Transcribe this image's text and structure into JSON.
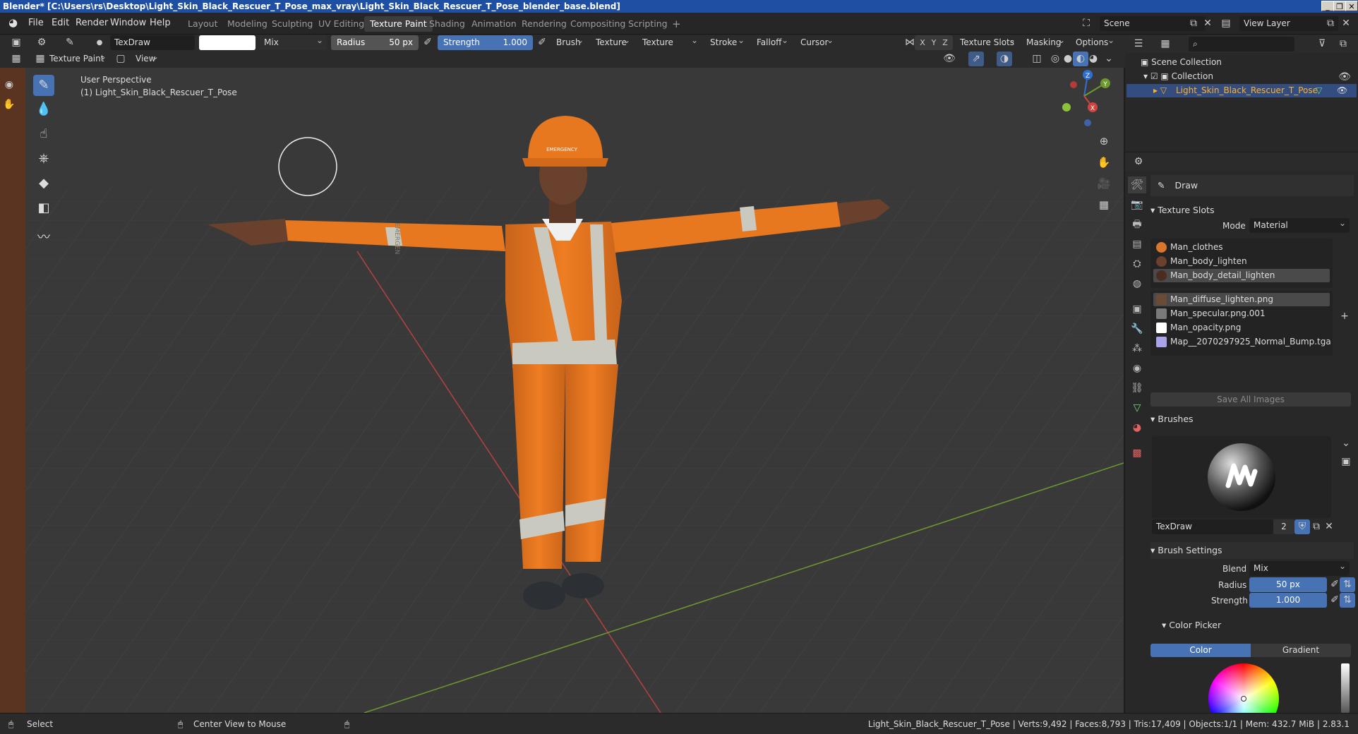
{
  "window": {
    "title": "Blender* [C:\\Users\\rs\\Desktop\\Light_Skin_Black_Rescuer_T_Pose_max_vray\\Light_Skin_Black_Rescuer_T_Pose_blender_base.blend]",
    "controls": [
      "_",
      "❐",
      "✕"
    ]
  },
  "menu": {
    "items": [
      "File",
      "Edit",
      "Render",
      "Window",
      "Help"
    ],
    "workspaces": [
      "Layout",
      "Modeling",
      "Sculpting",
      "UV Editing",
      "Texture Paint",
      "Shading",
      "Animation",
      "Rendering",
      "Compositing",
      "Scripting"
    ],
    "active_workspace": "Texture Paint",
    "add_tab": "+",
    "scene": "Scene",
    "view_layer": "View Layer"
  },
  "tool_header": {
    "brush_name": "TexDraw",
    "blend": "Mix",
    "radius_label": "Radius",
    "radius_value": "50 px",
    "strength_label": "Strength",
    "strength_value": "1.000",
    "strength_fraction": 1.0,
    "menus": [
      "Brush",
      "Texture",
      "Texture Mask",
      "Stroke",
      "Falloff",
      "Cursor"
    ],
    "axes": [
      "X",
      "Y",
      "Z"
    ],
    "right_menus": [
      "Texture Slots",
      "Masking",
      "Options"
    ]
  },
  "mode_header": {
    "mode": "Texture Paint",
    "view": "View"
  },
  "viewport": {
    "perspective": "User Perspective",
    "object": "(1) Light_Skin_Black_Rescuer_T_Pose",
    "gizmo_axes": [
      "Z",
      "Y",
      "X"
    ],
    "helmet_text": "EMERGENCY",
    "band_text": "EMERGEN"
  },
  "outliner": {
    "scene_collection": "Scene Collection",
    "collection": "Collection",
    "object": "Light_Skin_Black_Rescuer_T_Pose"
  },
  "properties": {
    "tool": "Draw",
    "texture_slots_title": "Texture Slots",
    "mode_label": "Mode",
    "mode_value": "Material",
    "materials": [
      "Man_clothes",
      "Man_body_lighten",
      "Man_body_detail_lighten"
    ],
    "selected_material": 2,
    "images": [
      {
        "name": "Man_diffuse_lighten.png",
        "color": "#6b4a36"
      },
      {
        "name": "Man_specular.png.001",
        "color": "#7a7a7a"
      },
      {
        "name": "Man_opacity.png",
        "color": "#ffffff"
      },
      {
        "name": "Map__2070297925_Normal_Bump.tga",
        "color": "#a9a4ea"
      }
    ],
    "selected_image": 0,
    "save_all": "Save All Images",
    "brushes_title": "Brushes",
    "brush_name": "TexDraw",
    "brush_users": "2",
    "brush_settings_title": "Brush Settings",
    "blend_label": "Blend",
    "blend_value": "Mix",
    "radius_label": "Radius",
    "radius_value": "50 px",
    "strength_label": "Strength",
    "strength_value": "1.000",
    "color_picker_title": "Color Picker",
    "color_tab": "Color",
    "gradient_tab": "Gradient"
  },
  "statusbar": {
    "select": "Select",
    "center": "Center View to Mouse",
    "stats": "Light_Skin_Black_Rescuer_T_Pose | Verts:9,492 | Faces:8,793 | Tris:17,409 | Objects:1/1 | Mem: 432.7 MiB | 2.83.1"
  },
  "colors": {
    "accent": "#4772b3",
    "suit": "#e8781f",
    "reflective": "#c9c9c0",
    "viewport_bg": "#393939"
  }
}
